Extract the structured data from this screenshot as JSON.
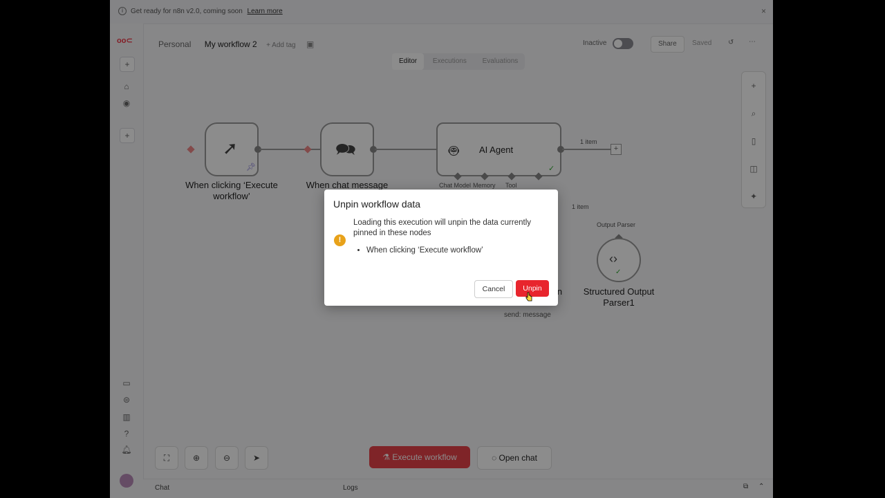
{
  "banner": {
    "text": "Get ready for n8n v2.0, coming soon",
    "link": "Learn more"
  },
  "header": {
    "project": "Personal",
    "workflow_title": "My workflow 2",
    "add_tag": "+ Add tag",
    "status_label": "Inactive",
    "share_label": "Share",
    "saved_label": "Saved"
  },
  "tabs": [
    "Editor",
    "Executions",
    "Evaluations"
  ],
  "nodes": {
    "manual_trigger": {
      "label_line1": "When clicking ‘Execute",
      "label_line2": "workflow’"
    },
    "chat_trigger": {
      "label": "When chat message"
    },
    "ai_agent": {
      "label": "AI Agent",
      "output_label": "1 item",
      "ports": [
        "Chat Model",
        "Memory",
        "Tool",
        "Output Parser"
      ]
    },
    "output_parser": {
      "label_line1": "Structured Output",
      "label_line2": "Parser1",
      "input_label": "Output Parser",
      "edge_label": "1 item"
    },
    "send_message": {
      "label_suffix": "in",
      "sublabel": "send: message"
    }
  },
  "bottom": {
    "execute_label": "Execute workflow",
    "open_chat_label": "Open chat"
  },
  "footer": {
    "chat": "Chat",
    "logs": "Logs"
  },
  "modal": {
    "title": "Unpin workflow data",
    "message": "Loading this execution will unpin the data currently pinned in these nodes",
    "items": [
      "When clicking ‘Execute workflow’"
    ],
    "cancel_label": "Cancel",
    "confirm_label": "Unpin"
  },
  "colors": {
    "accent_red": "#e8252d",
    "warning": "#e8a21a"
  }
}
